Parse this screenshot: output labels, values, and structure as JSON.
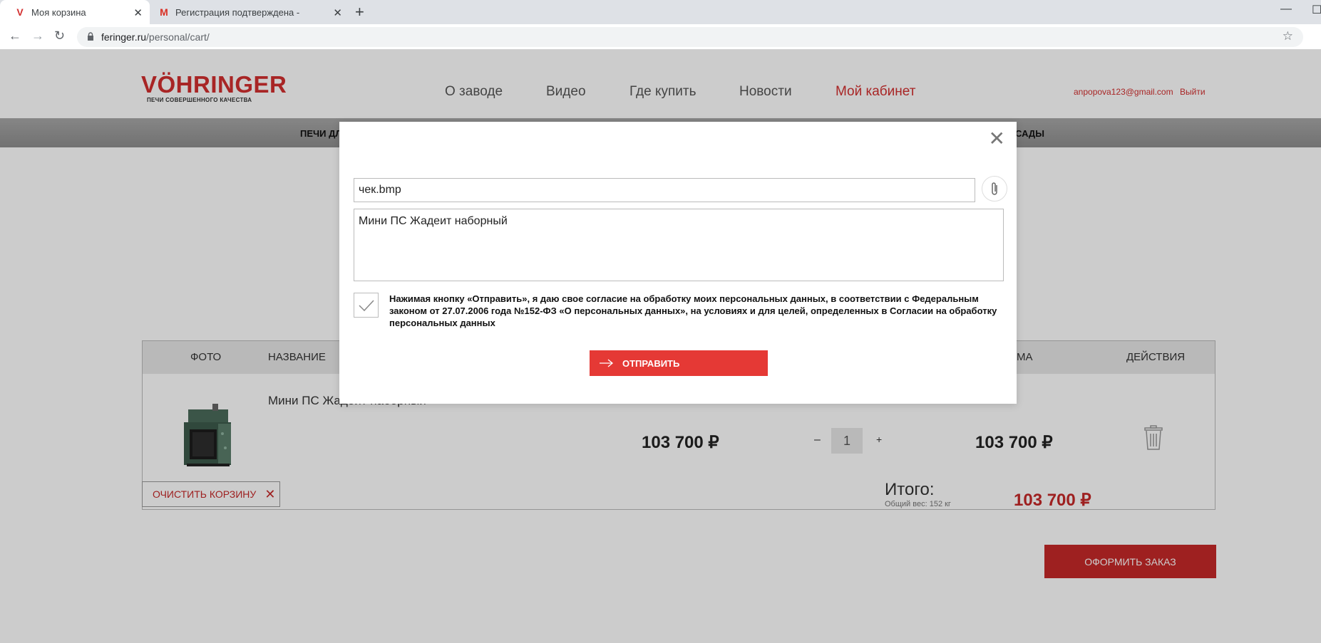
{
  "browser": {
    "tabs": [
      {
        "title": "Моя корзина",
        "favicon": "V",
        "active": true
      },
      {
        "title": "Регистрация подтверждена - ап",
        "favicon": "M",
        "active": false
      }
    ],
    "new_tab_symbol": "+",
    "tab_close_symbol": "✕",
    "window_controls": [
      "—",
      "☐"
    ],
    "url_domain": "feringer.ru",
    "url_path": "/personal/cart/"
  },
  "site": {
    "logo_text": "VÖHRINGER",
    "logo_tagline": "ПЕЧИ СОВЕРШЕННОГО КАЧЕСТВА",
    "nav": [
      "О заводе",
      "Видео",
      "Где купить",
      "Новости",
      "Мой кабинет"
    ],
    "active_nav": "Мой кабинет",
    "user_email": "anpopova123@gmail.com",
    "logout_label": "Выйти",
    "categories": [
      "ПЕЧИ ДЛ",
      "САДЫ"
    ]
  },
  "cart": {
    "headers": {
      "photo": "ФОТО",
      "name": "НАЗВАНИЕ",
      "sum": "МА",
      "actions": "ДЕЙСТВИЯ"
    },
    "item": {
      "name": "Мини ПС Жадеит наборный",
      "price": "103 700 ₽",
      "quantity": "1",
      "minus": "–",
      "plus": "+",
      "sum": "103 700 ₽"
    },
    "clear_label": "ОЧИСТИТЬ КОРЗИНУ",
    "total_label": "Итого:",
    "weight_label": "Общий вес: 152 кг",
    "total_value": "103 700 ₽",
    "order_label": "ОФОРМИТЬ ЗАКАЗ"
  },
  "modal": {
    "close_symbol": "✕",
    "file_value": "чек.bmp",
    "message_value": "Мини ПС Жадеит наборный",
    "consent_checked": true,
    "consent_text": "Нажимая кнопку «Отправить», я даю свое согласие на обработку моих персональных данных, в соответствии с Федеральным законом от 27.07.2006 года №152-ФЗ «О персональных данных», на условиях и для целей, определенных в Согласии на обработку персональных данных",
    "send_label": "ОТПРАВИТЬ"
  },
  "colors": {
    "brand_red": "#d32f2f",
    "button_red": "#e53935",
    "dark_red": "#c62828"
  }
}
